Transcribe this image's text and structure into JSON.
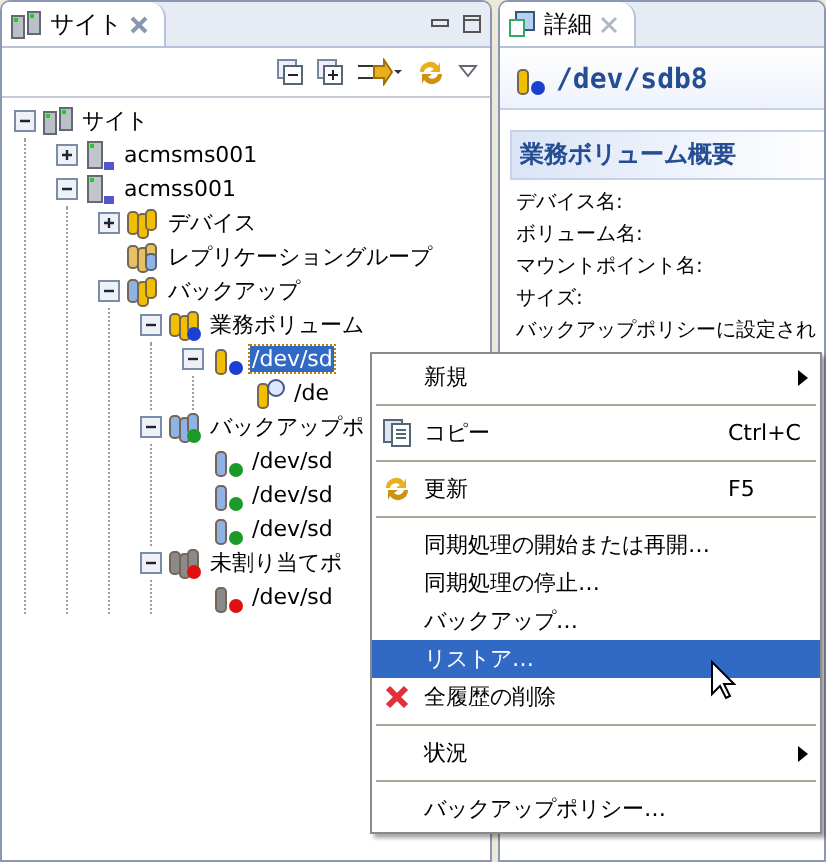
{
  "site_view": {
    "tab": {
      "title": "サイト"
    },
    "tree": [
      {
        "label": "サイト",
        "kind": "site",
        "expanded": true,
        "selected": false,
        "children": [
          {
            "label": "acmsms001",
            "kind": "server",
            "expanded": false,
            "selected": false
          },
          {
            "label": "acmss001",
            "kind": "server",
            "expanded": true,
            "selected": false,
            "children": [
              {
                "label": "デバイス",
                "kind": "devices",
                "expanded": false,
                "selected": false
              },
              {
                "label": "レプリケーショングループ",
                "kind": "replication",
                "selected": false
              },
              {
                "label": "バックアップ",
                "kind": "backup",
                "expanded": true,
                "selected": false,
                "children": [
                  {
                    "label": "業務ボリューム",
                    "kind": "business-group",
                    "expanded": true,
                    "selected": false,
                    "children": [
                      {
                        "label": "/dev/sd",
                        "kind": "business-volume",
                        "expanded": true,
                        "selected": true,
                        "children": [
                          {
                            "label": "/de",
                            "kind": "snapshot",
                            "selected": false
                          }
                        ]
                      }
                    ]
                  },
                  {
                    "label": "バックアップポ",
                    "kind": "policy-group",
                    "expanded": true,
                    "selected": false,
                    "children": [
                      {
                        "label": "/dev/sd",
                        "kind": "policy-volume",
                        "selected": false
                      },
                      {
                        "label": "/dev/sd",
                        "kind": "policy-volume",
                        "selected": false
                      },
                      {
                        "label": "/dev/sd",
                        "kind": "policy-volume",
                        "selected": false
                      }
                    ]
                  },
                  {
                    "label": "未割り当てポ",
                    "kind": "unassigned-group",
                    "expanded": true,
                    "selected": false,
                    "children": [
                      {
                        "label": "/dev/sd",
                        "kind": "unassigned-volume",
                        "selected": false
                      }
                    ]
                  }
                ]
              }
            ]
          }
        ]
      }
    ]
  },
  "detail_view": {
    "tab": {
      "title": "詳細"
    },
    "heading": "/dev/sdb8",
    "section": "業務ボリューム概要",
    "fields": [
      "デバイス名:",
      "ボリューム名:",
      "マウントポイント名:",
      "サイズ:",
      "バックアップポリシーに設定され"
    ]
  },
  "context_menu": [
    {
      "kind": "submenu",
      "label": "新規",
      "selected": false
    },
    {
      "kind": "separator"
    },
    {
      "kind": "copy",
      "label": "コピー",
      "shortcut": "Ctrl+C",
      "selected": false
    },
    {
      "kind": "separator"
    },
    {
      "kind": "refresh",
      "label": "更新",
      "shortcut": "F5",
      "selected": false
    },
    {
      "kind": "separator"
    },
    {
      "kind": "item",
      "label": "同期処理の開始または再開…",
      "selected": false
    },
    {
      "kind": "item",
      "label": "同期処理の停止…",
      "selected": false
    },
    {
      "kind": "item",
      "label": "バックアップ…",
      "selected": false
    },
    {
      "kind": "item",
      "label": "リストア…",
      "selected": true
    },
    {
      "kind": "delete",
      "label": "全履歴の削除",
      "selected": false
    },
    {
      "kind": "separator"
    },
    {
      "kind": "submenu",
      "label": "状況",
      "selected": false
    },
    {
      "kind": "separator"
    },
    {
      "kind": "item",
      "label": "バックアップポリシー…",
      "selected": false
    }
  ]
}
